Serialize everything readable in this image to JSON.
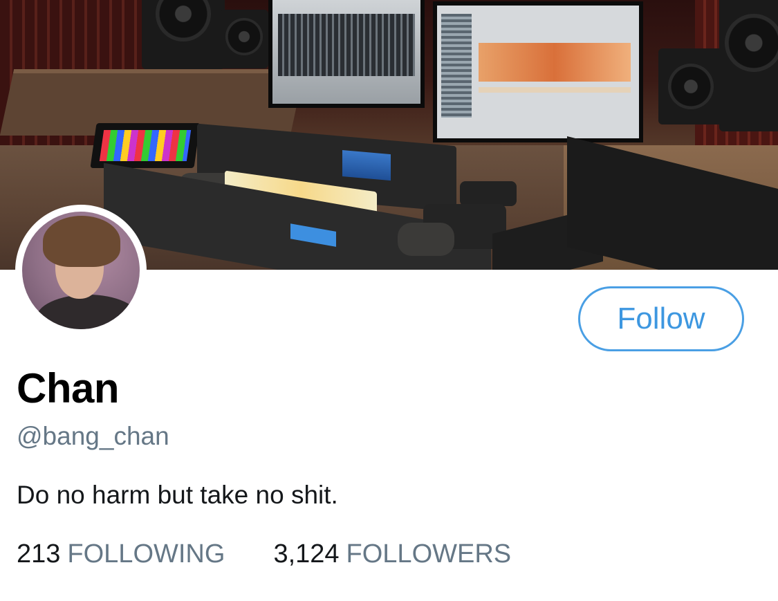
{
  "profile": {
    "display_name": "Chan",
    "handle": "@bang_chan",
    "bio": "Do no harm but take no shit.",
    "follow_label": "Follow"
  },
  "stats": {
    "following_count": "213",
    "following_label": "FOLLOWING",
    "followers_count": "3,124",
    "followers_label": "FOLLOWERS"
  },
  "colors": {
    "accent": "#4a9fe4",
    "secondary_text": "#657786",
    "primary_text": "#14171a"
  }
}
